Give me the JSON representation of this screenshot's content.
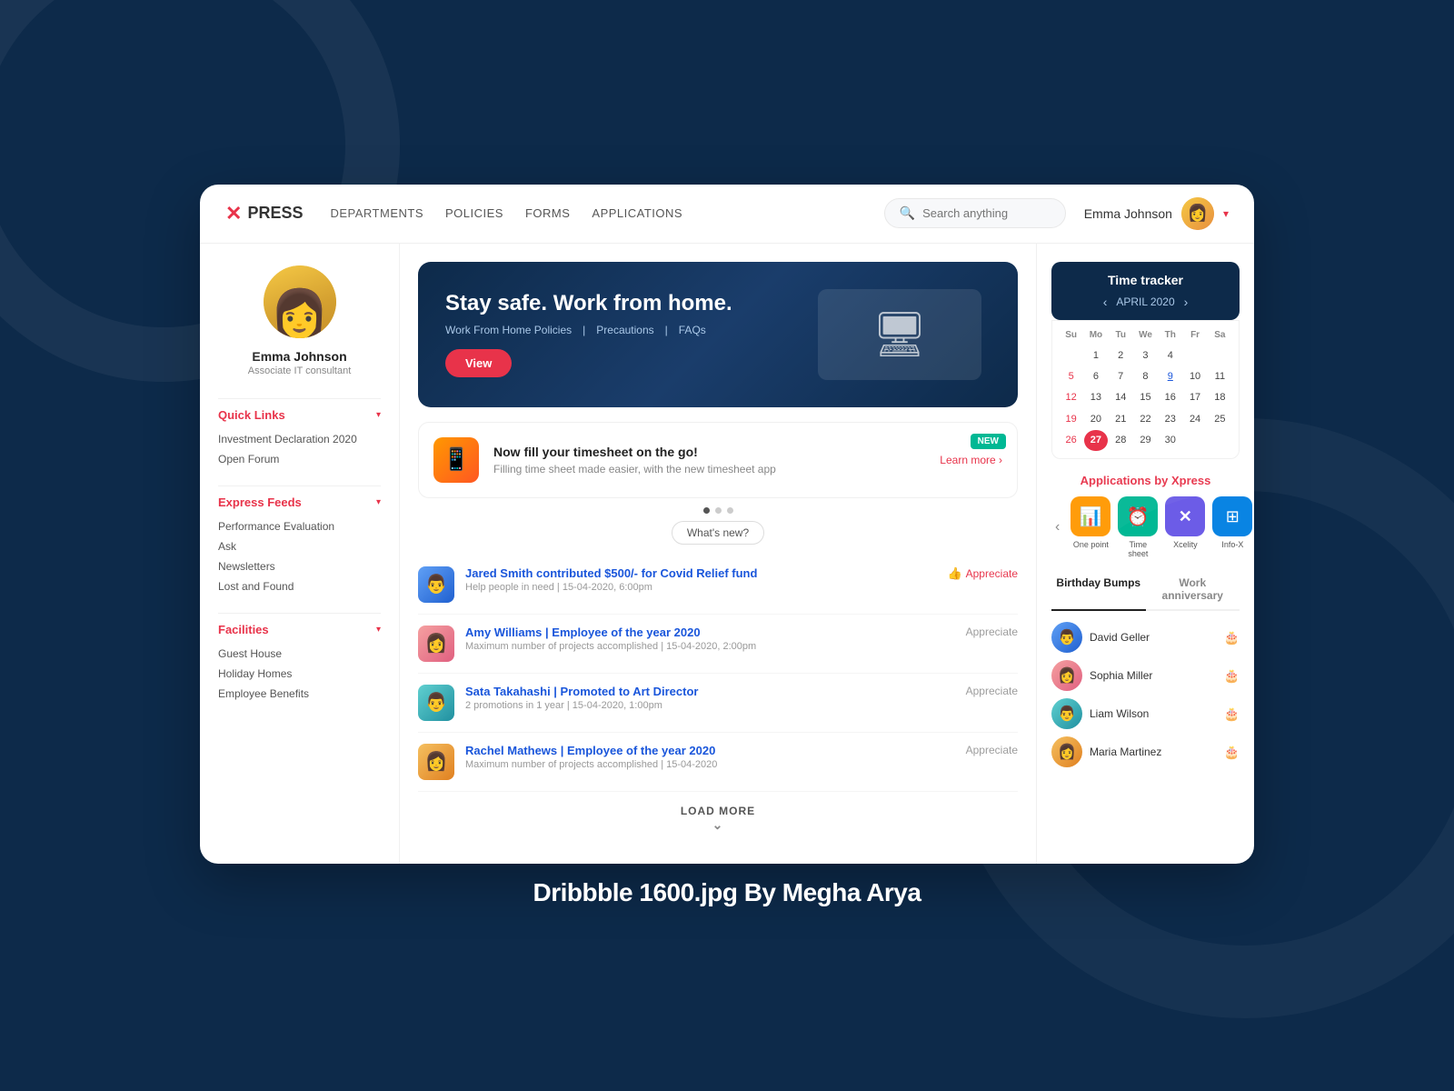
{
  "app": {
    "logo_text": "PRESS",
    "logo_icon": "✕"
  },
  "navbar": {
    "links": [
      "DEPARTMENTS",
      "POLICIES",
      "FORMS",
      "APPLICATIONS"
    ],
    "search_placeholder": "Search anything",
    "user_name": "Emma Johnson",
    "dropdown_arrow": "▾"
  },
  "sidebar": {
    "profile": {
      "name": "Emma Johnson",
      "role": "Associate IT consultant"
    },
    "quick_links": {
      "title": "Quick Links",
      "items": [
        "Investment Declaration 2020",
        "Open Forum"
      ]
    },
    "express_feeds": {
      "title": "Express Feeds",
      "items": [
        "Performance Evaluation",
        "Ask",
        "Newsletters",
        "Lost and Found"
      ]
    },
    "facilities": {
      "title": "Facilities",
      "items": [
        "Guest House",
        "Holiday Homes",
        "Employee Benefits"
      ]
    }
  },
  "hero": {
    "title": "Stay safe. Work from home.",
    "links": [
      "Work From Home Policies",
      "Precautions",
      "FAQs"
    ],
    "btn_label": "View"
  },
  "news_card": {
    "title": "Now fill your timesheet on the go!",
    "description": "Filling time sheet made easier, with the new timesheet app",
    "learn_more": "Learn more ›",
    "badge": "NEW"
  },
  "whats_new_label": "What's new?",
  "load_more_label": "LOAD MORE",
  "feed_items": [
    {
      "name": "Jared Smith",
      "action": "contributed $500/- for Covid Relief fund",
      "meta": "Help people in need  |  15-04-2020, 6:00pm",
      "appreciate": "Appreciate",
      "appreciated": true
    },
    {
      "name": "Amy Williams",
      "action": "Employee of the year 2020",
      "meta": "Maximum number of projects accomplished  |  15-04-2020, 2:00pm",
      "appreciate": "Appreciate",
      "appreciated": false
    },
    {
      "name": "Sata Takahashi",
      "action": "Promoted to Art Director",
      "meta": "2 promotions in 1 year  |  15-04-2020, 1:00pm",
      "appreciate": "Appreciate",
      "appreciated": false
    },
    {
      "name": "Rachel Mathews",
      "action": "Employee of the year 2020",
      "meta": "Maximum number of projects accomplished  |  15-04-2020",
      "appreciate": "Appreciate",
      "appreciated": false
    }
  ],
  "right_panel": {
    "time_tracker": {
      "title": "Time tracker",
      "month": "APRIL 2020",
      "day_names": [
        "Su",
        "Mo",
        "Tu",
        "We",
        "Th",
        "Fr",
        "Sa"
      ],
      "weeks": [
        [
          "",
          "",
          "",
          "1",
          "2",
          "3",
          "4"
        ],
        [
          "5",
          "6",
          "7",
          "8",
          "9",
          "10",
          "11"
        ],
        [
          "12",
          "13",
          "14",
          "15",
          "16",
          "17",
          "18"
        ],
        [
          "19",
          "20",
          "21",
          "22",
          "23",
          "24",
          "25"
        ],
        [
          "26",
          "27",
          "28",
          "29",
          "30",
          "",
          ""
        ]
      ],
      "today": "27",
      "underline_day": "9"
    },
    "apps": {
      "title": "Applications by Xpress",
      "items": [
        {
          "label": "One point",
          "color": "app-orange",
          "icon": "📊"
        },
        {
          "label": "Time sheet",
          "color": "app-teal",
          "icon": "⏰"
        },
        {
          "label": "Xcelity",
          "color": "app-purple",
          "icon": "✕"
        },
        {
          "label": "Info-X",
          "color": "app-blue",
          "icon": "⊞"
        }
      ]
    },
    "birthday_tabs": [
      "Birthday Bumps",
      "Work anniversary"
    ],
    "birthday_list": [
      {
        "name": "David Geller",
        "emoji": "👨"
      },
      {
        "name": "Sophia Miller",
        "emoji": "👩"
      },
      {
        "name": "Liam Wilson",
        "emoji": "👨"
      },
      {
        "name": "Maria Martinez",
        "emoji": "👩"
      }
    ]
  },
  "watermark": "Dribbble 1600.jpg By Megha Arya"
}
